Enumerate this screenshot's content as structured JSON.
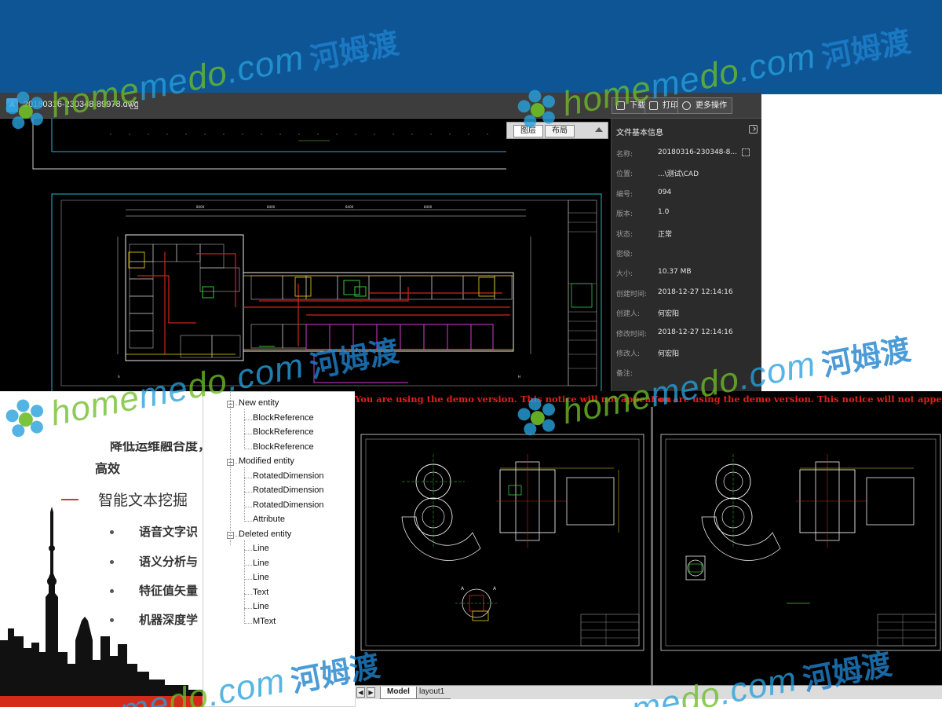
{
  "viewer": {
    "file_name": "20180316-230348-89978.dwg",
    "toolbar": {
      "download_label": "下载",
      "print_label": "打印",
      "more_label": "更多操作"
    },
    "layer_tabs": [
      "图层",
      "布局"
    ],
    "info_panel": {
      "title": "文件基本信息",
      "rows": [
        {
          "key": "名称:",
          "value": "20180316-230348-8..."
        },
        {
          "key": "位置:",
          "value": "...\\测试\\CAD"
        },
        {
          "key": "编号:",
          "value": "094"
        },
        {
          "key": "版本:",
          "value": "1.0"
        },
        {
          "key": "状态:",
          "value": "正常"
        },
        {
          "key": "密级:",
          "value": ""
        },
        {
          "key": "大小:",
          "value": "10.37 MB"
        },
        {
          "key": "创建时间:",
          "value": "2018-12-27 12:14:16"
        },
        {
          "key": "创建人:",
          "value": "何宏阳"
        },
        {
          "key": "修改时间:",
          "value": "2018-12-27 12:14:16"
        },
        {
          "key": "修改人:",
          "value": "何宏阳"
        },
        {
          "key": "备注:",
          "value": ""
        }
      ]
    }
  },
  "slide": {
    "cut_line": "降低运维融合度，",
    "efficient": "高效",
    "main_bullet": "智能文本挖掘",
    "sub_items": [
      "语音文字识",
      "语义分析与",
      "特征值矢量",
      "机器深度学"
    ]
  },
  "tree": {
    "groups": [
      {
        "label": "New entity",
        "children": [
          "BlockReference",
          "BlockReference",
          "BlockReference"
        ]
      },
      {
        "label": "Modified entity",
        "children": [
          "RotatedDimension",
          "RotatedDimension",
          "RotatedDimension",
          "Attribute"
        ]
      },
      {
        "label": "Deleted entity",
        "children": [
          "Line",
          "Line",
          "Line",
          "Text",
          "Line",
          "MText"
        ]
      }
    ]
  },
  "demo": {
    "notice_left": "You are using the demo version. This notice will not appear on",
    "notice_right": "You are using the demo version. This notice will not appear o",
    "sheet_tabs": [
      "Model",
      "layout1"
    ]
  },
  "watermark": {
    "text_green_1": "home",
    "text_green_2": "do",
    "text_blue_1": "me",
    "text_blue_2": ".com",
    "text_cn": "河姆渡"
  },
  "colors": {
    "slide_blue": "#0e5596",
    "accent_red": "#d03a2a",
    "notice_red": "#e0201c",
    "watermark_green": "#6ebe28",
    "watermark_blue": "#1e82cd"
  }
}
